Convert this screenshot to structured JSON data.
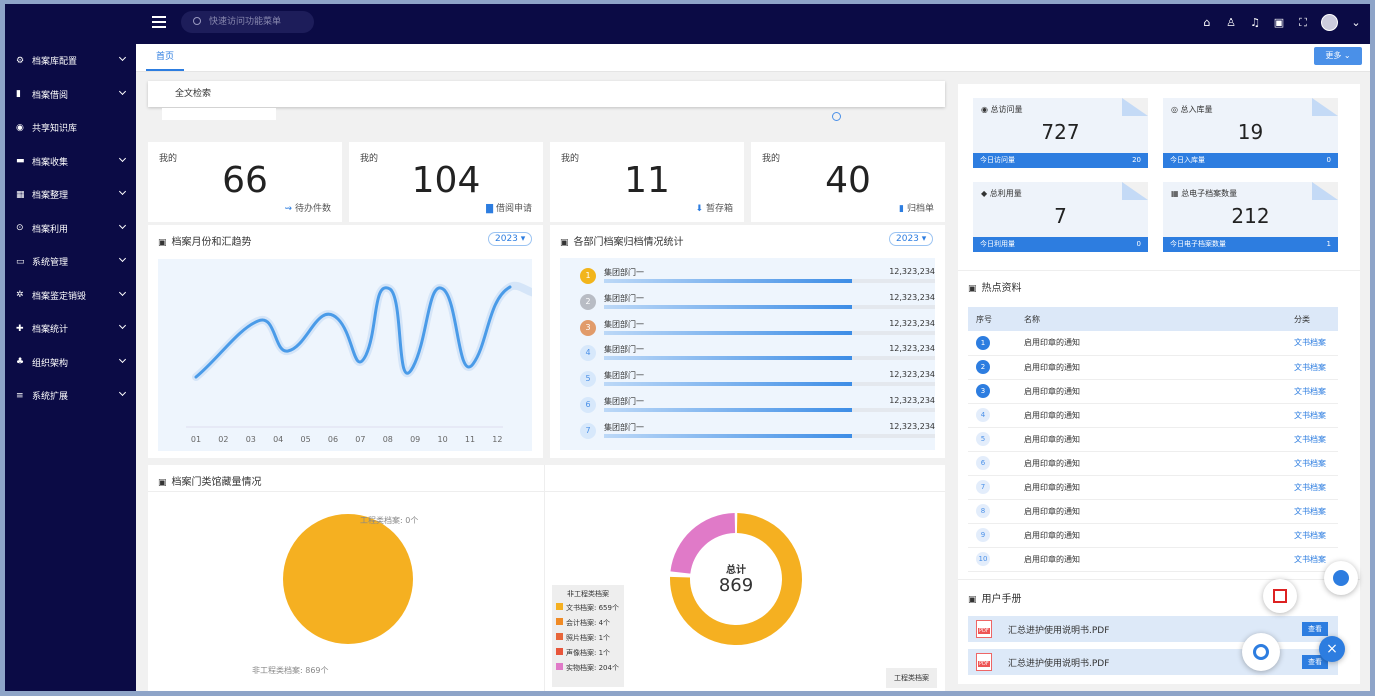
{
  "header": {
    "search_placeholder": "快速访问功能菜单"
  },
  "sidebar": {
    "items": [
      {
        "label": "档案库配置",
        "icon": "gear-icon"
      },
      {
        "label": "档案借阅",
        "icon": "book-icon"
      },
      {
        "label": "共享知识库",
        "icon": "share-icon"
      },
      {
        "label": "档案收集",
        "icon": "collect-icon"
      },
      {
        "label": "档案整理",
        "icon": "folder-icon"
      },
      {
        "label": "档案利用",
        "icon": "use-icon"
      },
      {
        "label": "系统管理",
        "icon": "monitor-icon"
      },
      {
        "label": "档案鉴定销毁",
        "icon": "cog-icon"
      },
      {
        "label": "档案统计",
        "icon": "stats-icon"
      },
      {
        "label": "组织架构",
        "icon": "org-icon"
      },
      {
        "label": "系统扩展",
        "icon": "list-icon"
      }
    ]
  },
  "tabs": [
    {
      "label": "首页"
    }
  ],
  "more_label": "更多",
  "fulltext": {
    "label": "全文检索"
  },
  "stats": [
    {
      "label": "我的",
      "value": "66",
      "sub": "待办件数",
      "color": "#2d7de0"
    },
    {
      "label": "我的",
      "value": "104",
      "sub": "借阅申请",
      "color": "#2d7de0"
    },
    {
      "label": "我的",
      "value": "11",
      "sub": "暂存箱",
      "color": "#2d7de0"
    },
    {
      "label": "我的",
      "value": "40",
      "sub": "归档单",
      "color": "#2d7de0"
    }
  ],
  "trend": {
    "title": "档案月份和汇趋势",
    "year": "2023",
    "months": [
      "01",
      "02",
      "03",
      "04",
      "05",
      "06",
      "07",
      "08",
      "09",
      "10",
      "11",
      "12"
    ]
  },
  "dept": {
    "title": "各部门档案归档情况统计",
    "year": "2023",
    "rows": [
      {
        "rank": "1",
        "name": "集团部门一",
        "value": "12,323,234",
        "fill": 0.75
      },
      {
        "rank": "2",
        "name": "集团部门一",
        "value": "12,323,234",
        "fill": 0.75
      },
      {
        "rank": "3",
        "name": "集团部门一",
        "value": "12,323,234",
        "fill": 0.75
      },
      {
        "rank": "4",
        "name": "集团部门一",
        "value": "12,323,234",
        "fill": 0.75
      },
      {
        "rank": "5",
        "name": "集团部门一",
        "value": "12,323,234",
        "fill": 0.75
      },
      {
        "rank": "6",
        "name": "集团部门一",
        "value": "12,323,234",
        "fill": 0.75
      },
      {
        "rank": "7",
        "name": "集团部门一",
        "value": "12,323,234",
        "fill": 0.75
      }
    ]
  },
  "category": {
    "title": "档案门类馆藏量情况",
    "pie_labels": {
      "eng": "工程类档案: 0个",
      "noneng": "非工程类档案: 869个"
    },
    "donut_center": {
      "label": "总计",
      "value": "869"
    },
    "legend_title": "非工程类档案",
    "legend": [
      {
        "label": "文书档案: 659个",
        "color": "#f5b021"
      },
      {
        "label": "会计档案: 4个",
        "color": "#f08a24"
      },
      {
        "label": "照片档案: 1个",
        "color": "#e8663a"
      },
      {
        "label": "声像档案: 1个",
        "color": "#e8553a"
      },
      {
        "label": "实物档案: 204个",
        "color": "#e07ac8"
      }
    ],
    "eng_legend_title": "工程类档案"
  },
  "right_stats": [
    {
      "label": "总访问量",
      "value": "727",
      "foot_label": "今日访问量",
      "foot_value": "20"
    },
    {
      "label": "总入库量",
      "value": "19",
      "foot_label": "今日入库量",
      "foot_value": "0"
    },
    {
      "label": "总利用量",
      "value": "7",
      "foot_label": "今日利用量",
      "foot_value": "0"
    },
    {
      "label": "总电子档案数量",
      "value": "212",
      "foot_label": "今日电子档案数量",
      "foot_value": "1"
    }
  ],
  "hot": {
    "title": "热点资料",
    "headers": [
      "序号",
      "名称",
      "分类"
    ],
    "rows": [
      {
        "no": "1",
        "name": "启用印章的通知",
        "cls": "文书档案"
      },
      {
        "no": "2",
        "name": "启用印章的通知",
        "cls": "文书档案"
      },
      {
        "no": "3",
        "name": "启用印章的通知",
        "cls": "文书档案"
      },
      {
        "no": "4",
        "name": "启用印章的通知",
        "cls": "文书档案"
      },
      {
        "no": "5",
        "name": "启用印章的通知",
        "cls": "文书档案"
      },
      {
        "no": "6",
        "name": "启用印章的通知",
        "cls": "文书档案"
      },
      {
        "no": "7",
        "name": "启用印章的通知",
        "cls": "文书档案"
      },
      {
        "no": "8",
        "name": "启用印章的通知",
        "cls": "文书档案"
      },
      {
        "no": "9",
        "name": "启用印章的通知",
        "cls": "文书档案"
      },
      {
        "no": "10",
        "name": "启用印章的通知",
        "cls": "文书档案"
      }
    ]
  },
  "manual": {
    "title": "用户手册",
    "rows": [
      {
        "name": "汇总进护使用说明书.PDF",
        "btn": "查看"
      },
      {
        "name": "汇总进护使用说明书.PDF",
        "btn": "查看"
      }
    ]
  }
}
